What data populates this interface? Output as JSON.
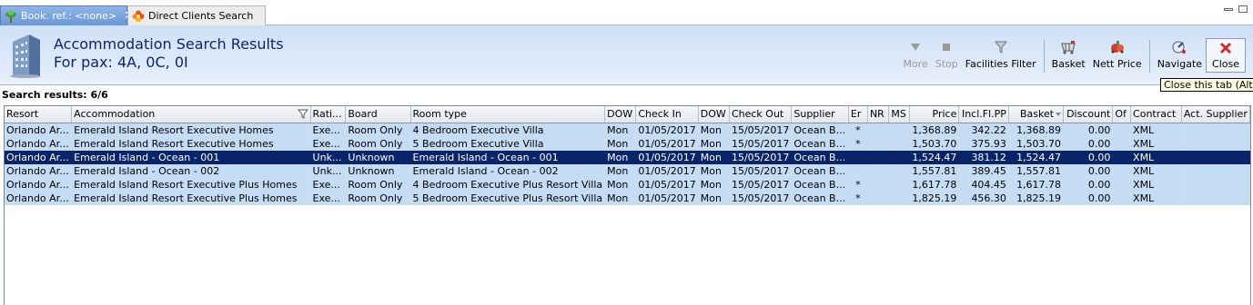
{
  "tabs": [
    {
      "label": "Book. ref.: <none>",
      "icon": "palm-tree-icon",
      "active": true
    },
    {
      "label": "Direct Clients Search",
      "icon": "flower-icon",
      "active": false
    }
  ],
  "header": {
    "title": "Accommodation Search Results",
    "subtitle": "For pax: 4A, 0C, 0I"
  },
  "toolbar": {
    "more": "More",
    "stop": "Stop",
    "facilities_filter": "Facilities Filter",
    "basket": "Basket",
    "nett_price": "Nett Price",
    "navigate": "Navigate",
    "close": "Close"
  },
  "tooltip": "Close this tab (Alt+C",
  "results_label": "Search results: 6/6",
  "columns": [
    "Resort",
    "Accommodation",
    "Rati...",
    "Board",
    "Room type",
    "DOW",
    "Check In",
    "DOW",
    "Check Out",
    "Supplier",
    "Er",
    "NR",
    "MS",
    "Price",
    "Incl.Fl.PP",
    "Basket",
    "Discount",
    "Of",
    "Contract",
    "Act. Supplier"
  ],
  "rows": [
    {
      "resort": "Orlando Ar...",
      "accommodation": "Emerald Island Resort Executive Homes",
      "rating": "Exe...",
      "board": "Room Only",
      "room_type": "4 Bedroom Executive Villa",
      "dow1": "Mon",
      "check_in": "01/05/2017",
      "dow2": "Mon",
      "check_out": "15/05/2017",
      "supplier": "Ocean B...",
      "er": "*",
      "nr": "",
      "ms": "",
      "price": "1,368.89",
      "incl": "342.22",
      "basket": "1,368.89",
      "discount": "0.00",
      "of": "",
      "contract": "XML",
      "act_supplier": "",
      "selected": false
    },
    {
      "resort": "Orlando Ar...",
      "accommodation": "Emerald Island Resort Executive Homes",
      "rating": "Exe...",
      "board": "Room Only",
      "room_type": "5 Bedroom Executive Villa",
      "dow1": "Mon",
      "check_in": "01/05/2017",
      "dow2": "Mon",
      "check_out": "15/05/2017",
      "supplier": "Ocean B...",
      "er": "*",
      "nr": "",
      "ms": "",
      "price": "1,503.70",
      "incl": "375.93",
      "basket": "1,503.70",
      "discount": "0.00",
      "of": "",
      "contract": "XML",
      "act_supplier": "",
      "selected": false
    },
    {
      "resort": "Orlando Ar...",
      "accommodation": "Emerald Island - Ocean - 001",
      "rating": "Unk...",
      "board": "Unknown",
      "room_type": "Emerald Island - Ocean - 001",
      "dow1": "Mon",
      "check_in": "01/05/2017",
      "dow2": "Mon",
      "check_out": "15/05/2017",
      "supplier": "Ocean B...",
      "er": "",
      "nr": "",
      "ms": "",
      "price": "1,524.47",
      "incl": "381.12",
      "basket": "1,524.47",
      "discount": "0.00",
      "of": "",
      "contract": "XML",
      "act_supplier": "",
      "selected": true
    },
    {
      "resort": "Orlando Ar...",
      "accommodation": "Emerald Island - Ocean - 002",
      "rating": "Unk...",
      "board": "Unknown",
      "room_type": "Emerald Island - Ocean - 002",
      "dow1": "Mon",
      "check_in": "01/05/2017",
      "dow2": "Mon",
      "check_out": "15/05/2017",
      "supplier": "Ocean B...",
      "er": "",
      "nr": "",
      "ms": "",
      "price": "1,557.81",
      "incl": "389.45",
      "basket": "1,557.81",
      "discount": "0.00",
      "of": "",
      "contract": "XML",
      "act_supplier": "",
      "selected": false
    },
    {
      "resort": "Orlando Ar...",
      "accommodation": "Emerald Island Resort Executive Plus Homes",
      "rating": "Exe...",
      "board": "Room Only",
      "room_type": "4 Bedroom Executive Plus Resort Villa",
      "dow1": "Mon",
      "check_in": "01/05/2017",
      "dow2": "Mon",
      "check_out": "15/05/2017",
      "supplier": "Ocean B...",
      "er": "*",
      "nr": "",
      "ms": "",
      "price": "1,617.78",
      "incl": "404.45",
      "basket": "1,617.78",
      "discount": "0.00",
      "of": "",
      "contract": "XML",
      "act_supplier": "",
      "selected": false
    },
    {
      "resort": "Orlando Ar...",
      "accommodation": "Emerald Island Resort Executive Plus Homes",
      "rating": "Exe...",
      "board": "Room Only",
      "room_type": "5 Bedroom Executive Plus Resort Villa",
      "dow1": "Mon",
      "check_in": "01/05/2017",
      "dow2": "Mon",
      "check_out": "15/05/2017",
      "supplier": "Ocean B...",
      "er": "*",
      "nr": "",
      "ms": "",
      "price": "1,825.19",
      "incl": "456.30",
      "basket": "1,825.19",
      "discount": "0.00",
      "of": "",
      "contract": "XML",
      "act_supplier": "",
      "selected": false
    }
  ],
  "colors": {
    "row_bg": "#c5dcf5",
    "selected_bg": "#0a246a",
    "header_title": "#10246a"
  }
}
